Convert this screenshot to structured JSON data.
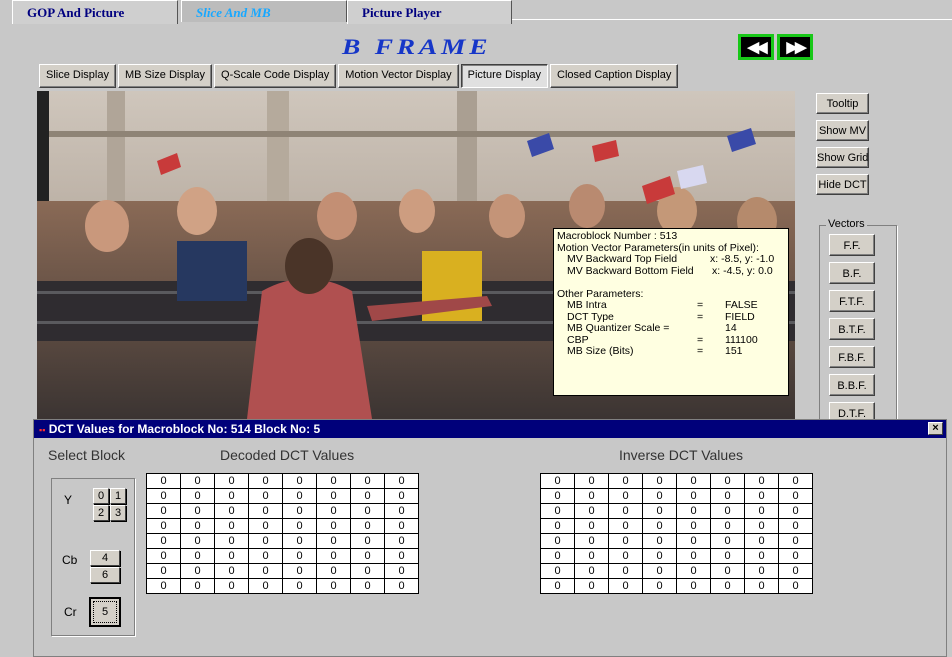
{
  "tabs": [
    {
      "label": "GOP And Picture",
      "active": false
    },
    {
      "label": "Slice And MB",
      "active": true
    },
    {
      "label": "Picture Player",
      "active": false
    }
  ],
  "frame_title": "B FRAME",
  "nav": {
    "prev_icon": "rewind-icon",
    "next_icon": "fast-forward-icon",
    "prev_glyph": "◀◀",
    "next_glyph": "▶▶"
  },
  "modes": [
    {
      "label": "Slice Display",
      "pressed": false
    },
    {
      "label": "MB Size Display",
      "pressed": false
    },
    {
      "label": "Q-Scale Code Display",
      "pressed": false
    },
    {
      "label": "Motion Vector Display",
      "pressed": false
    },
    {
      "label": "Picture Display",
      "pressed": true
    },
    {
      "label": "Closed Caption Display",
      "pressed": false
    }
  ],
  "side_buttons": [
    "Tooltip",
    "Show MV",
    "Show Grid",
    "Hide DCT"
  ],
  "vectors": {
    "legend": "Vectors",
    "buttons": [
      "F.F.",
      "B.F.",
      "F.T.F.",
      "B.T.F.",
      "F.B.F.",
      "B.B.F.",
      "D.T.F."
    ]
  },
  "tooltip": {
    "line1": "Macroblock Number : 513",
    "line2": "Motion Vector Parameters(in units of Pixel):",
    "mv_top_label": "MV Backward Top Field",
    "mv_top_value": "x: -8.5, y: -1.0",
    "mv_bottom_label": "MV Backward Bottom Field",
    "mv_bottom_value": "x: -4.5, y: 0.0",
    "other": "Other Parameters:",
    "params": [
      {
        "k": "MB Intra",
        "eq": "=",
        "v": "FALSE"
      },
      {
        "k": "DCT Type",
        "eq": "=",
        "v": "FIELD"
      },
      {
        "k": "MB Quantizer Scale =",
        "eq": "",
        "v": "14"
      },
      {
        "k": "CBP",
        "eq": "=",
        "v": "111100"
      },
      {
        "k": "MB Size (Bits)",
        "eq": "=",
        "v": "151"
      }
    ]
  },
  "dct": {
    "title": "DCT Values for Macroblock No:  514   Block No: 5",
    "close_glyph": "×",
    "select_label": "Select Block",
    "decoded_label": "Decoded DCT Values",
    "inverse_label": "Inverse DCT Values",
    "y_label": "Y",
    "cb_label": "Cb",
    "cr_label": "Cr",
    "y_blocks": [
      "0",
      "1",
      "2",
      "3"
    ],
    "cb_blocks": [
      "4",
      "6"
    ],
    "cr_block": "5",
    "decoded": [
      [
        "0",
        "0",
        "0",
        "0",
        "0",
        "0",
        "0",
        "0"
      ],
      [
        "0",
        "0",
        "0",
        "0",
        "0",
        "0",
        "0",
        "0"
      ],
      [
        "0",
        "0",
        "0",
        "0",
        "0",
        "0",
        "0",
        "0"
      ],
      [
        "0",
        "0",
        "0",
        "0",
        "0",
        "0",
        "0",
        "0"
      ],
      [
        "0",
        "0",
        "0",
        "0",
        "0",
        "0",
        "0",
        "0"
      ],
      [
        "0",
        "0",
        "0",
        "0",
        "0",
        "0",
        "0",
        "0"
      ],
      [
        "0",
        "0",
        "0",
        "0",
        "0",
        "0",
        "0",
        "0"
      ],
      [
        "0",
        "0",
        "0",
        "0",
        "0",
        "0",
        "0",
        "0"
      ]
    ],
    "inverse": [
      [
        "0",
        "0",
        "0",
        "0",
        "0",
        "0",
        "0",
        "0"
      ],
      [
        "0",
        "0",
        "0",
        "0",
        "0",
        "0",
        "0",
        "0"
      ],
      [
        "0",
        "0",
        "0",
        "0",
        "0",
        "0",
        "0",
        "0"
      ],
      [
        "0",
        "0",
        "0",
        "0",
        "0",
        "0",
        "0",
        "0"
      ],
      [
        "0",
        "0",
        "0",
        "0",
        "0",
        "0",
        "0",
        "0"
      ],
      [
        "0",
        "0",
        "0",
        "0",
        "0",
        "0",
        "0",
        "0"
      ],
      [
        "0",
        "0",
        "0",
        "0",
        "0",
        "0",
        "0",
        "0"
      ],
      [
        "0",
        "0",
        "0",
        "0",
        "0",
        "0",
        "0",
        "0"
      ]
    ]
  }
}
